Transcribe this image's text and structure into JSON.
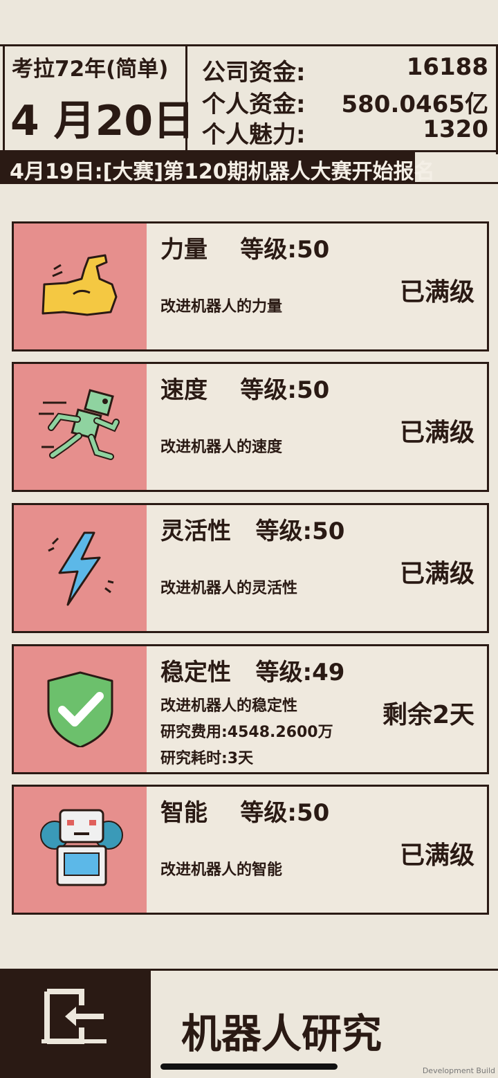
{
  "header": {
    "year_mode": "考拉72年(简单)",
    "date": "4 月20日",
    "company_funds_label": "公司资金:",
    "company_funds_value": "16188",
    "personal_funds_label": "个人资金:",
    "personal_funds_value": "580.0465亿",
    "charisma_label": "个人魅力:",
    "charisma_value": "1320"
  },
  "news": {
    "text": "4月19日:[大赛]第120期机器人大赛开始报名"
  },
  "cards": [
    {
      "title": "力量    等级:50",
      "desc": "改进机器人的力量",
      "status": "已满级",
      "icon": "muscle-arm-icon"
    },
    {
      "title": "速度    等级:50",
      "desc": "改进机器人的速度",
      "status": "已满级",
      "icon": "running-robot-icon"
    },
    {
      "title": "灵活性   等级:50",
      "desc": "改进机器人的灵活性",
      "status": "已满级",
      "icon": "lightning-bolt-icon"
    },
    {
      "title": "稳定性   等级:49",
      "desc": "改进机器人的稳定性",
      "cost": "研究费用:4548.2600万",
      "time": "研究耗时:3天",
      "status": "剩余2天",
      "icon": "shield-check-icon"
    },
    {
      "title": "智能    等级:50",
      "desc": "改进机器人的智能",
      "status": "已满级",
      "icon": "robot-gear-icon"
    }
  ],
  "footer": {
    "title": "机器人研究",
    "dev_label": "Development Build"
  },
  "colors": {
    "dark": "#2a1a14",
    "background": "#ece7dc",
    "icon_panel": "#e68f8d"
  }
}
